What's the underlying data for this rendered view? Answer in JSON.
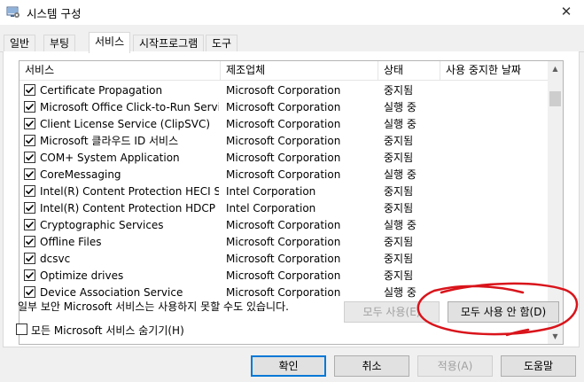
{
  "window": {
    "title": "시스템 구성",
    "close_glyph": "✕"
  },
  "tabs": [
    {
      "label": "일반"
    },
    {
      "label": "부팅"
    },
    {
      "label": "서비스"
    },
    {
      "label": "시작프로그램"
    },
    {
      "label": "도구"
    }
  ],
  "active_tab": "서비스",
  "columns": [
    "서비스",
    "제조업체",
    "상태",
    "사용 중지한 날짜"
  ],
  "services": [
    {
      "name": "Certificate Propagation",
      "maker": "Microsoft Corporation",
      "status": "중지됨",
      "checked": true
    },
    {
      "name": "Microsoft Office Click-to-Run Service",
      "maker": "Microsoft Corporation",
      "status": "실행 중",
      "checked": true
    },
    {
      "name": "Client License Service (ClipSVC)",
      "maker": "Microsoft Corporation",
      "status": "실행 중",
      "checked": true
    },
    {
      "name": "Microsoft 클라우드 ID 서비스",
      "maker": "Microsoft Corporation",
      "status": "중지됨",
      "checked": true
    },
    {
      "name": "COM+ System Application",
      "maker": "Microsoft Corporation",
      "status": "중지됨",
      "checked": true
    },
    {
      "name": "CoreMessaging",
      "maker": "Microsoft Corporation",
      "status": "실행 중",
      "checked": true
    },
    {
      "name": "Intel(R) Content Protection HECI Se...",
      "maker": "Intel Corporation",
      "status": "중지됨",
      "checked": true
    },
    {
      "name": "Intel(R) Content Protection HDCP S...",
      "maker": "Intel Corporation",
      "status": "중지됨",
      "checked": true
    },
    {
      "name": "Cryptographic Services",
      "maker": "Microsoft Corporation",
      "status": "실행 중",
      "checked": true
    },
    {
      "name": "Offline Files",
      "maker": "Microsoft Corporation",
      "status": "중지됨",
      "checked": true
    },
    {
      "name": "dcsvc",
      "maker": "Microsoft Corporation",
      "status": "중지됨",
      "checked": true
    },
    {
      "name": "Optimize drives",
      "maker": "Microsoft Corporation",
      "status": "중지됨",
      "checked": true
    },
    {
      "name": "Device Association Service",
      "maker": "Microsoft Corporation",
      "status": "실행 중",
      "checked": true
    }
  ],
  "scrollbar": {
    "up_glyph": "▲",
    "down_glyph": "▼"
  },
  "note": "일부 보안 Microsoft 서비스는 사용하지 못할 수도 있습니다.",
  "buttons": {
    "enable_all": "모두 사용(E)",
    "disable_all": "모두 사용 안 함(D)",
    "ok": "확인",
    "cancel": "취소",
    "apply": "적용(A)",
    "help": "도움말"
  },
  "hide_ms_label": "모든 Microsoft 서비스 숨기기(H)",
  "hide_ms_checked": false,
  "colors": {
    "annotation_red": "#d9141b",
    "focus_blue": "#0078d7"
  }
}
